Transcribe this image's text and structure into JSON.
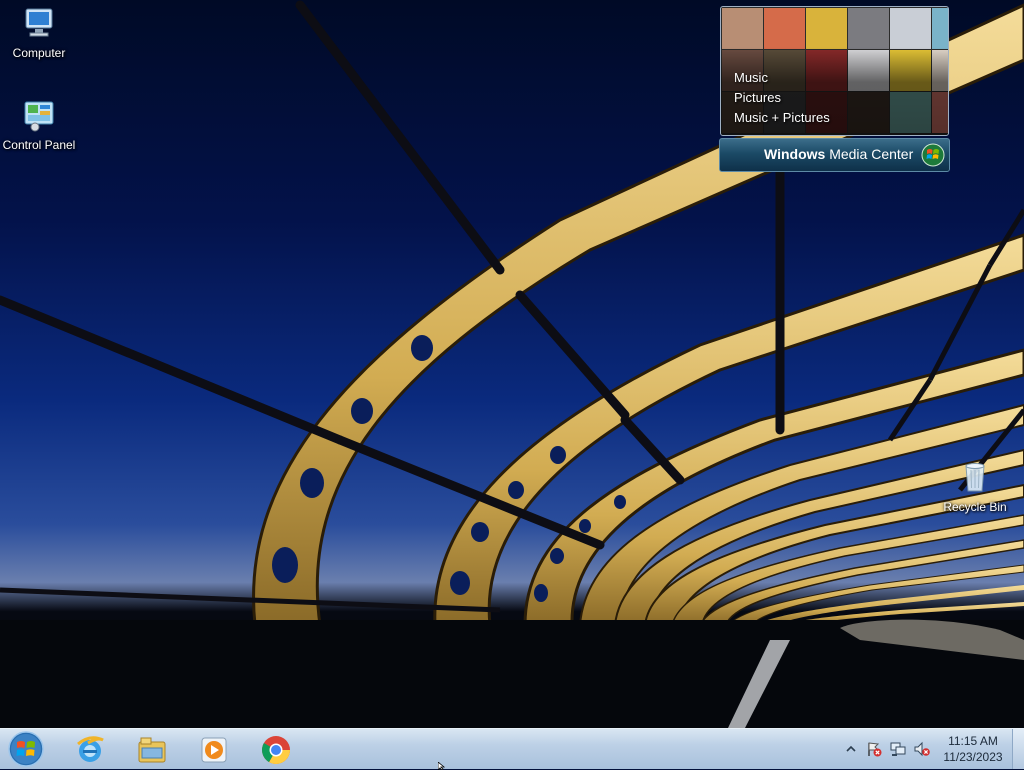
{
  "desktop": {
    "icons": [
      {
        "label": "Computer"
      },
      {
        "label": "Control Panel"
      },
      {
        "label": "Recycle Bin"
      }
    ]
  },
  "media_center": {
    "menu": [
      "Music",
      "Pictures",
      "Music + Pictures"
    ],
    "brand_bold": "Windows",
    "brand_rest": " Media Center"
  },
  "taskbar": {
    "apps": [
      {
        "icon": "internet-explorer-icon"
      },
      {
        "icon": "file-explorer-icon"
      },
      {
        "icon": "media-player-icon"
      },
      {
        "icon": "chrome-icon"
      }
    ],
    "tray": {
      "icons": [
        "show-hidden-icons-chevron",
        "action-center-flag-icon",
        "network-icon",
        "volume-muted-icon"
      ]
    },
    "clock": {
      "time": "11:15 AM",
      "date": "11/23/2023"
    }
  },
  "colors": {
    "taskbar": "#bcd0e6",
    "sky_dark": "#000a26",
    "sky_blue": "#0a2a7e",
    "bridge_gold": "#d8b35a"
  }
}
